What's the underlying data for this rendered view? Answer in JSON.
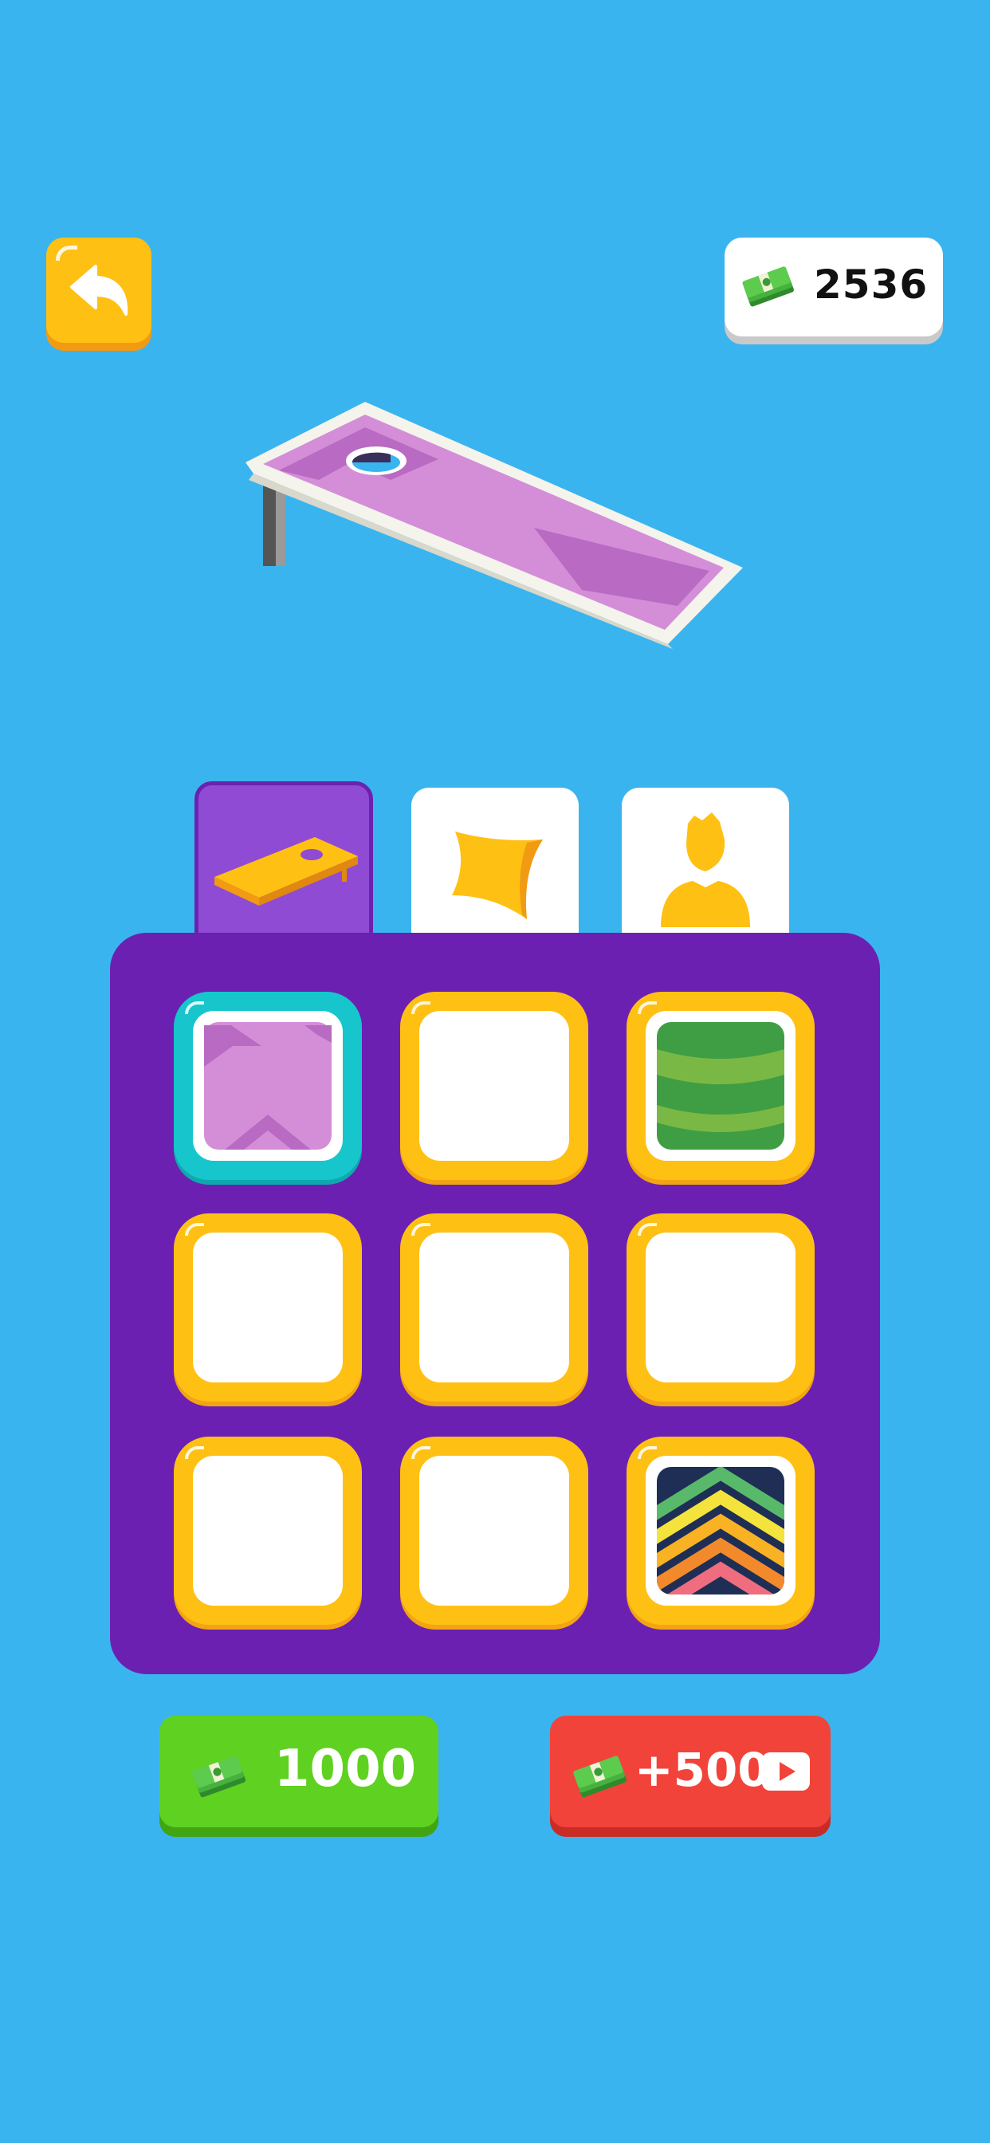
{
  "header": {
    "back_icon": "back-arrow-icon",
    "coins": "2536",
    "currency_icon": "cash-stack-icon"
  },
  "preview": {
    "item": "cornhole-board",
    "skin_color": "#d48ed8"
  },
  "tabs": [
    {
      "name": "boards",
      "icon": "cornhole-board-icon",
      "active": true
    },
    {
      "name": "bags",
      "icon": "beanbag-icon",
      "active": false
    },
    {
      "name": "characters",
      "icon": "person-icon",
      "active": false
    }
  ],
  "grid": [
    {
      "state": "selected",
      "skin": "purple-chevron"
    },
    {
      "state": "locked",
      "skin": ""
    },
    {
      "state": "owned",
      "skin": "green-stripes"
    },
    {
      "state": "locked",
      "skin": ""
    },
    {
      "state": "locked",
      "skin": ""
    },
    {
      "state": "locked",
      "skin": ""
    },
    {
      "state": "locked",
      "skin": ""
    },
    {
      "state": "locked",
      "skin": ""
    },
    {
      "state": "owned",
      "skin": "rainbow-chevron"
    }
  ],
  "buttons": {
    "buy_label": "1000",
    "ad_label": "+500",
    "ad_icon": "video-play-icon"
  },
  "colors": {
    "background": "#3ab4ee",
    "panel": "#6c20b2",
    "cell_border": "#ffc014",
    "selected_border": "#16c6cc",
    "buy_button": "#5fd120",
    "ad_button": "#f2433a"
  }
}
